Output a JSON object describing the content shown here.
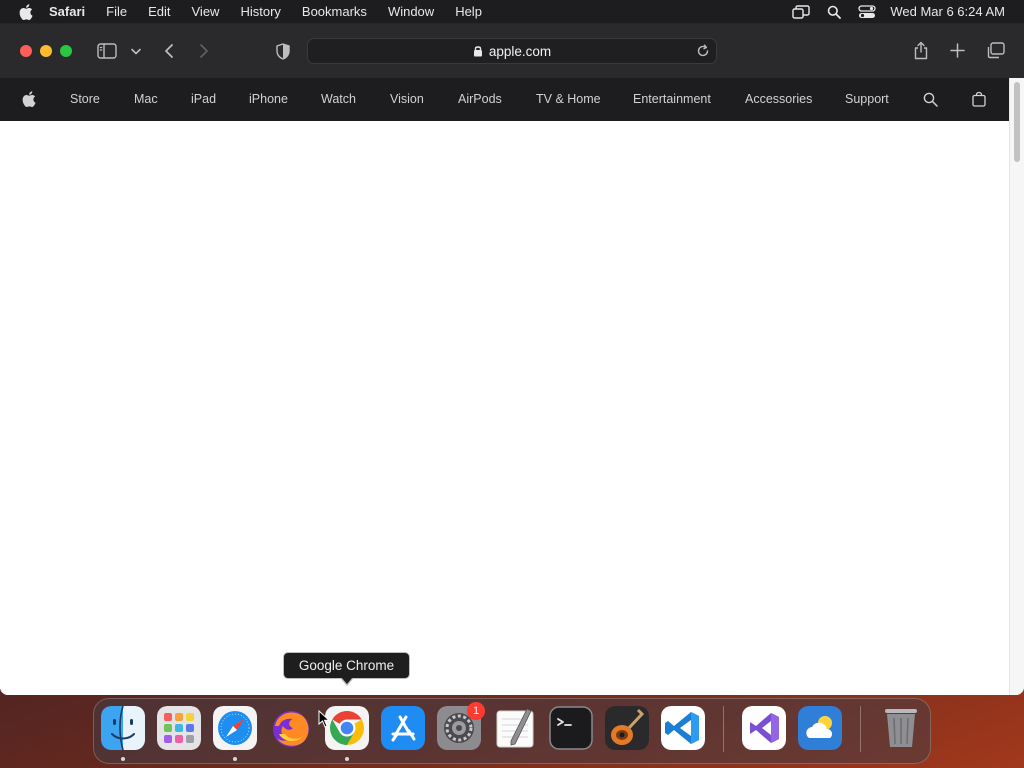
{
  "menubar": {
    "app_name": "Safari",
    "menus": [
      "File",
      "Edit",
      "View",
      "History",
      "Bookmarks",
      "Window",
      "Help"
    ],
    "clock": "Wed Mar 6  6:24 AM",
    "status_icons": [
      "screen-mirroring-icon",
      "spotlight-icon",
      "control-center-icon"
    ]
  },
  "safari": {
    "address": "apple.com",
    "toolbar_icons": [
      "sidebar-icon",
      "chevron-down-icon",
      "back-icon",
      "forward-icon",
      "shield-icon",
      "share-icon",
      "plus-icon",
      "tabs-icon"
    ]
  },
  "site_nav": {
    "items": [
      "Store",
      "Mac",
      "iPad",
      "iPhone",
      "Watch",
      "Vision",
      "AirPods",
      "TV & Home",
      "Entertainment",
      "Accessories",
      "Support"
    ]
  },
  "tooltip": {
    "text": "Google Chrome"
  },
  "dock": {
    "apps": [
      "Finder",
      "Launchpad",
      "Safari",
      "Firefox",
      "Google Chrome",
      "App Store",
      "System Settings",
      "TextEdit",
      "Terminal",
      "GarageBand",
      "Visual Studio Code",
      "Visual Studio",
      "Weather",
      "Trash"
    ],
    "settings_badge": "1"
  },
  "colors": {
    "menubar_bg": "#1d1d1f",
    "toolbar_bg": "#2a2a2c",
    "close": "#ff5f57",
    "minimize": "#febc2e",
    "maximize": "#28c840",
    "badge": "#ff3b30"
  }
}
